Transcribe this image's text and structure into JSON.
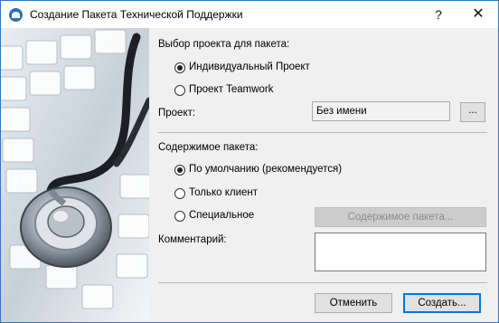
{
  "window": {
    "title": "Создание Пакета Технической Поддержки",
    "help_glyph": "?",
    "close_glyph": "✕"
  },
  "project_section": {
    "heading": "Выбор проекта для пакета:",
    "options": [
      {
        "label": "Индивидуальный Проект",
        "checked": true
      },
      {
        "label": "Проект Teamwork",
        "checked": false
      }
    ],
    "project_label": "Проект:",
    "project_value": "Без имени",
    "browse_label": "..."
  },
  "content_section": {
    "heading": "Содержимое пакета:",
    "options": [
      {
        "label": "По умолчанию (рекомендуется)",
        "checked": true
      },
      {
        "label": "Только клиент",
        "checked": false
      },
      {
        "label": "Специальное",
        "checked": false
      }
    ],
    "contents_button": "Содержимое пакета...",
    "comment_label": "Комментарий:",
    "comment_value": ""
  },
  "footer": {
    "cancel_label": "Отменить",
    "create_label": "Создать..."
  },
  "colors": {
    "accent": "#0078d7",
    "window_border": "#2b79c8",
    "dialog_bg": "#f0f0f0"
  }
}
